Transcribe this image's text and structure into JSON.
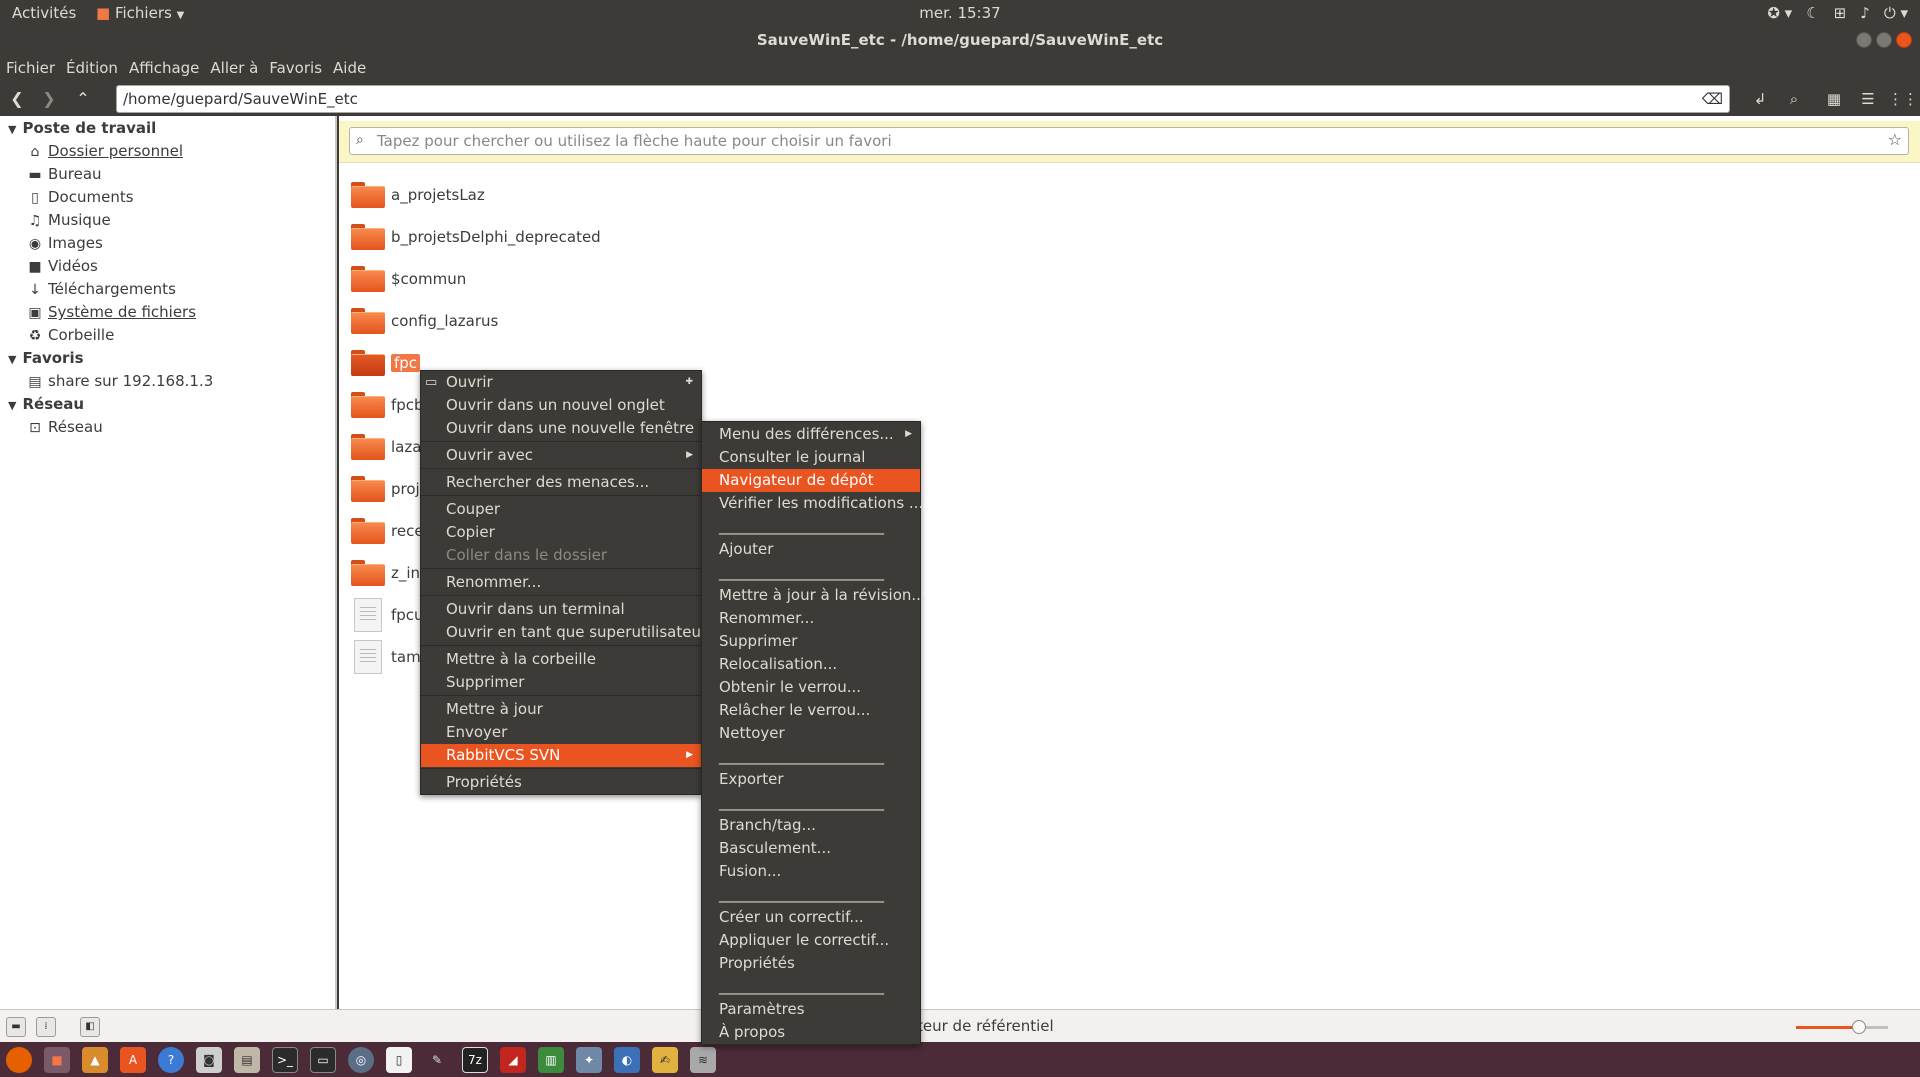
{
  "topbar": {
    "activities": "Activités",
    "app_menu": "Fichiers",
    "clock": "mer. 15:37"
  },
  "window": {
    "title": "SauveWinE_etc - /home/guepard/SauveWinE_etc"
  },
  "menubar": [
    "Fichier",
    "Édition",
    "Affichage",
    "Aller à",
    "Favoris",
    "Aide"
  ],
  "location": {
    "path": "/home/guepard/SauveWinE_etc"
  },
  "search": {
    "placeholder": "Tapez pour chercher ou utilisez la flèche haute pour choisir un favori"
  },
  "sidebar": {
    "sections": [
      {
        "title": "Poste de travail"
      },
      {
        "title": "Favoris"
      },
      {
        "title": "Réseau"
      }
    ],
    "items": [
      {
        "label": "Dossier personnel",
        "icon": "home-icon"
      },
      {
        "label": "Bureau",
        "icon": "desktop-icon"
      },
      {
        "label": "Documents",
        "icon": "documents-icon"
      },
      {
        "label": "Musique",
        "icon": "music-icon"
      },
      {
        "label": "Images",
        "icon": "camera-icon"
      },
      {
        "label": "Vidéos",
        "icon": "video-icon"
      },
      {
        "label": "Téléchargements",
        "icon": "download-icon"
      },
      {
        "label": "Système de fichiers",
        "icon": "filesystem-icon"
      },
      {
        "label": "Corbeille",
        "icon": "trash-icon"
      },
      {
        "label": "share sur 192.168.1.3",
        "icon": "network-share-icon"
      },
      {
        "label": "Réseau",
        "icon": "network-icon"
      }
    ]
  },
  "files": [
    {
      "name": "a_projetsLaz",
      "type": "folder"
    },
    {
      "name": "b_projetsDelphi_deprecated",
      "type": "folder"
    },
    {
      "name": "$commun",
      "type": "folder"
    },
    {
      "name": "config_lazarus",
      "type": "folder"
    },
    {
      "name": "fpc",
      "type": "folder",
      "selected": true
    },
    {
      "name": "fpcb",
      "type": "folder"
    },
    {
      "name": "laza",
      "type": "folder"
    },
    {
      "name": "proj",
      "type": "folder"
    },
    {
      "name": "rece",
      "type": "folder"
    },
    {
      "name": "z_ins",
      "type": "folder"
    },
    {
      "name": "fpcu",
      "type": "file"
    },
    {
      "name": "tam",
      "type": "file"
    }
  ],
  "context_menu": {
    "items": [
      {
        "label": "Ouvrir"
      },
      {
        "label": "Ouvrir dans un nouvel onglet"
      },
      {
        "label": "Ouvrir dans une nouvelle fenêtre"
      },
      {
        "label": "Ouvrir avec"
      },
      {
        "label": "Rechercher des menaces..."
      },
      {
        "label": "Couper"
      },
      {
        "label": "Copier"
      },
      {
        "label": "Coller dans le dossier"
      },
      {
        "label": "Renommer..."
      },
      {
        "label": "Ouvrir dans un terminal"
      },
      {
        "label": "Ouvrir en tant que superutilisateur"
      },
      {
        "label": "Mettre à la corbeille"
      },
      {
        "label": "Supprimer"
      },
      {
        "label": "Mettre à jour"
      },
      {
        "label": "Envoyer"
      },
      {
        "label": "RabbitVCS SVN"
      },
      {
        "label": "Propriétés"
      }
    ]
  },
  "submenu": {
    "separator_text": "______________________",
    "items": [
      {
        "label": "Menu des différences..."
      },
      {
        "label": "Consulter le journal"
      },
      {
        "label": "Navigateur de dépôt"
      },
      {
        "label": "Vérifier les modifications ..."
      },
      {
        "label": "Ajouter"
      },
      {
        "label": "Mettre à jour à la révision..."
      },
      {
        "label": "Renommer..."
      },
      {
        "label": "Supprimer"
      },
      {
        "label": "Relocalisation..."
      },
      {
        "label": "Obtenir le verrou..."
      },
      {
        "label": "Relâcher le verrou..."
      },
      {
        "label": "Nettoyer"
      },
      {
        "label": "Exporter"
      },
      {
        "label": "Branch/tag..."
      },
      {
        "label": "Basculement..."
      },
      {
        "label": "Fusion..."
      },
      {
        "label": "Créer un correctif..."
      },
      {
        "label": "Appliquer le correctif..."
      },
      {
        "label": "Propriétés"
      },
      {
        "label": "Paramètres"
      },
      {
        "label": "À propos"
      }
    ]
  },
  "statusbar": {
    "text": "teur de référentiel"
  },
  "colors": {
    "accent": "#e95420",
    "panel": "#3c3b37",
    "taskbar": "#4c2b38",
    "search_bar": "#fbf6c5"
  }
}
